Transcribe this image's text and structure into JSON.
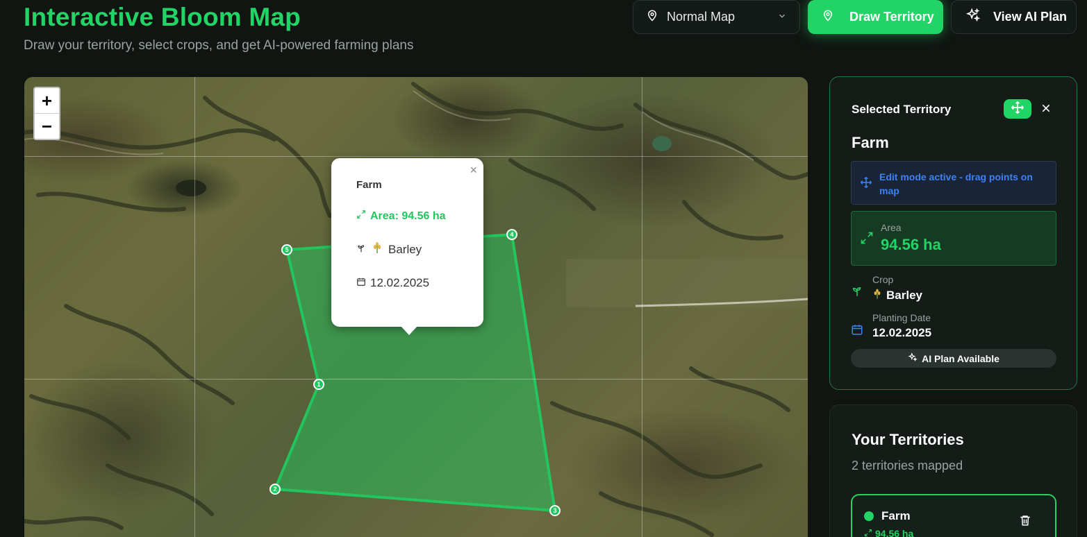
{
  "header": {
    "title": "Interactive Bloom Map",
    "subtitle": "Draw your territory, select crops, and get AI-powered farming plans"
  },
  "toolbar": {
    "map_type": "Normal Map",
    "draw_label": "Draw Territory",
    "ai_label": "View AI Plan"
  },
  "map": {
    "zoom_in": "+",
    "zoom_out": "−",
    "vertices": [
      "1",
      "2",
      "3",
      "4",
      "5"
    ],
    "popup": {
      "close": "×",
      "name": "Farm",
      "area": "Area: 94.56 ha",
      "crop": "Barley",
      "date": "12.02.2025"
    }
  },
  "selected": {
    "heading": "Selected Territory",
    "name": "Farm",
    "edit_notice": "Edit mode active - drag points on map",
    "area_label": "Area",
    "area_value": "94.56 ha",
    "crop_label": "Crop",
    "crop_value": "Barley",
    "date_label": "Planting Date",
    "date_value": "12.02.2025",
    "ai_plan": "AI Plan Available"
  },
  "territories": {
    "heading": "Your Territories",
    "count": "2 territories mapped",
    "items": [
      {
        "name": "Farm",
        "area": "94.56 ha"
      }
    ]
  },
  "colors": {
    "accent": "#22d465",
    "background": "#101512",
    "info_blue": "#3b82f6"
  }
}
